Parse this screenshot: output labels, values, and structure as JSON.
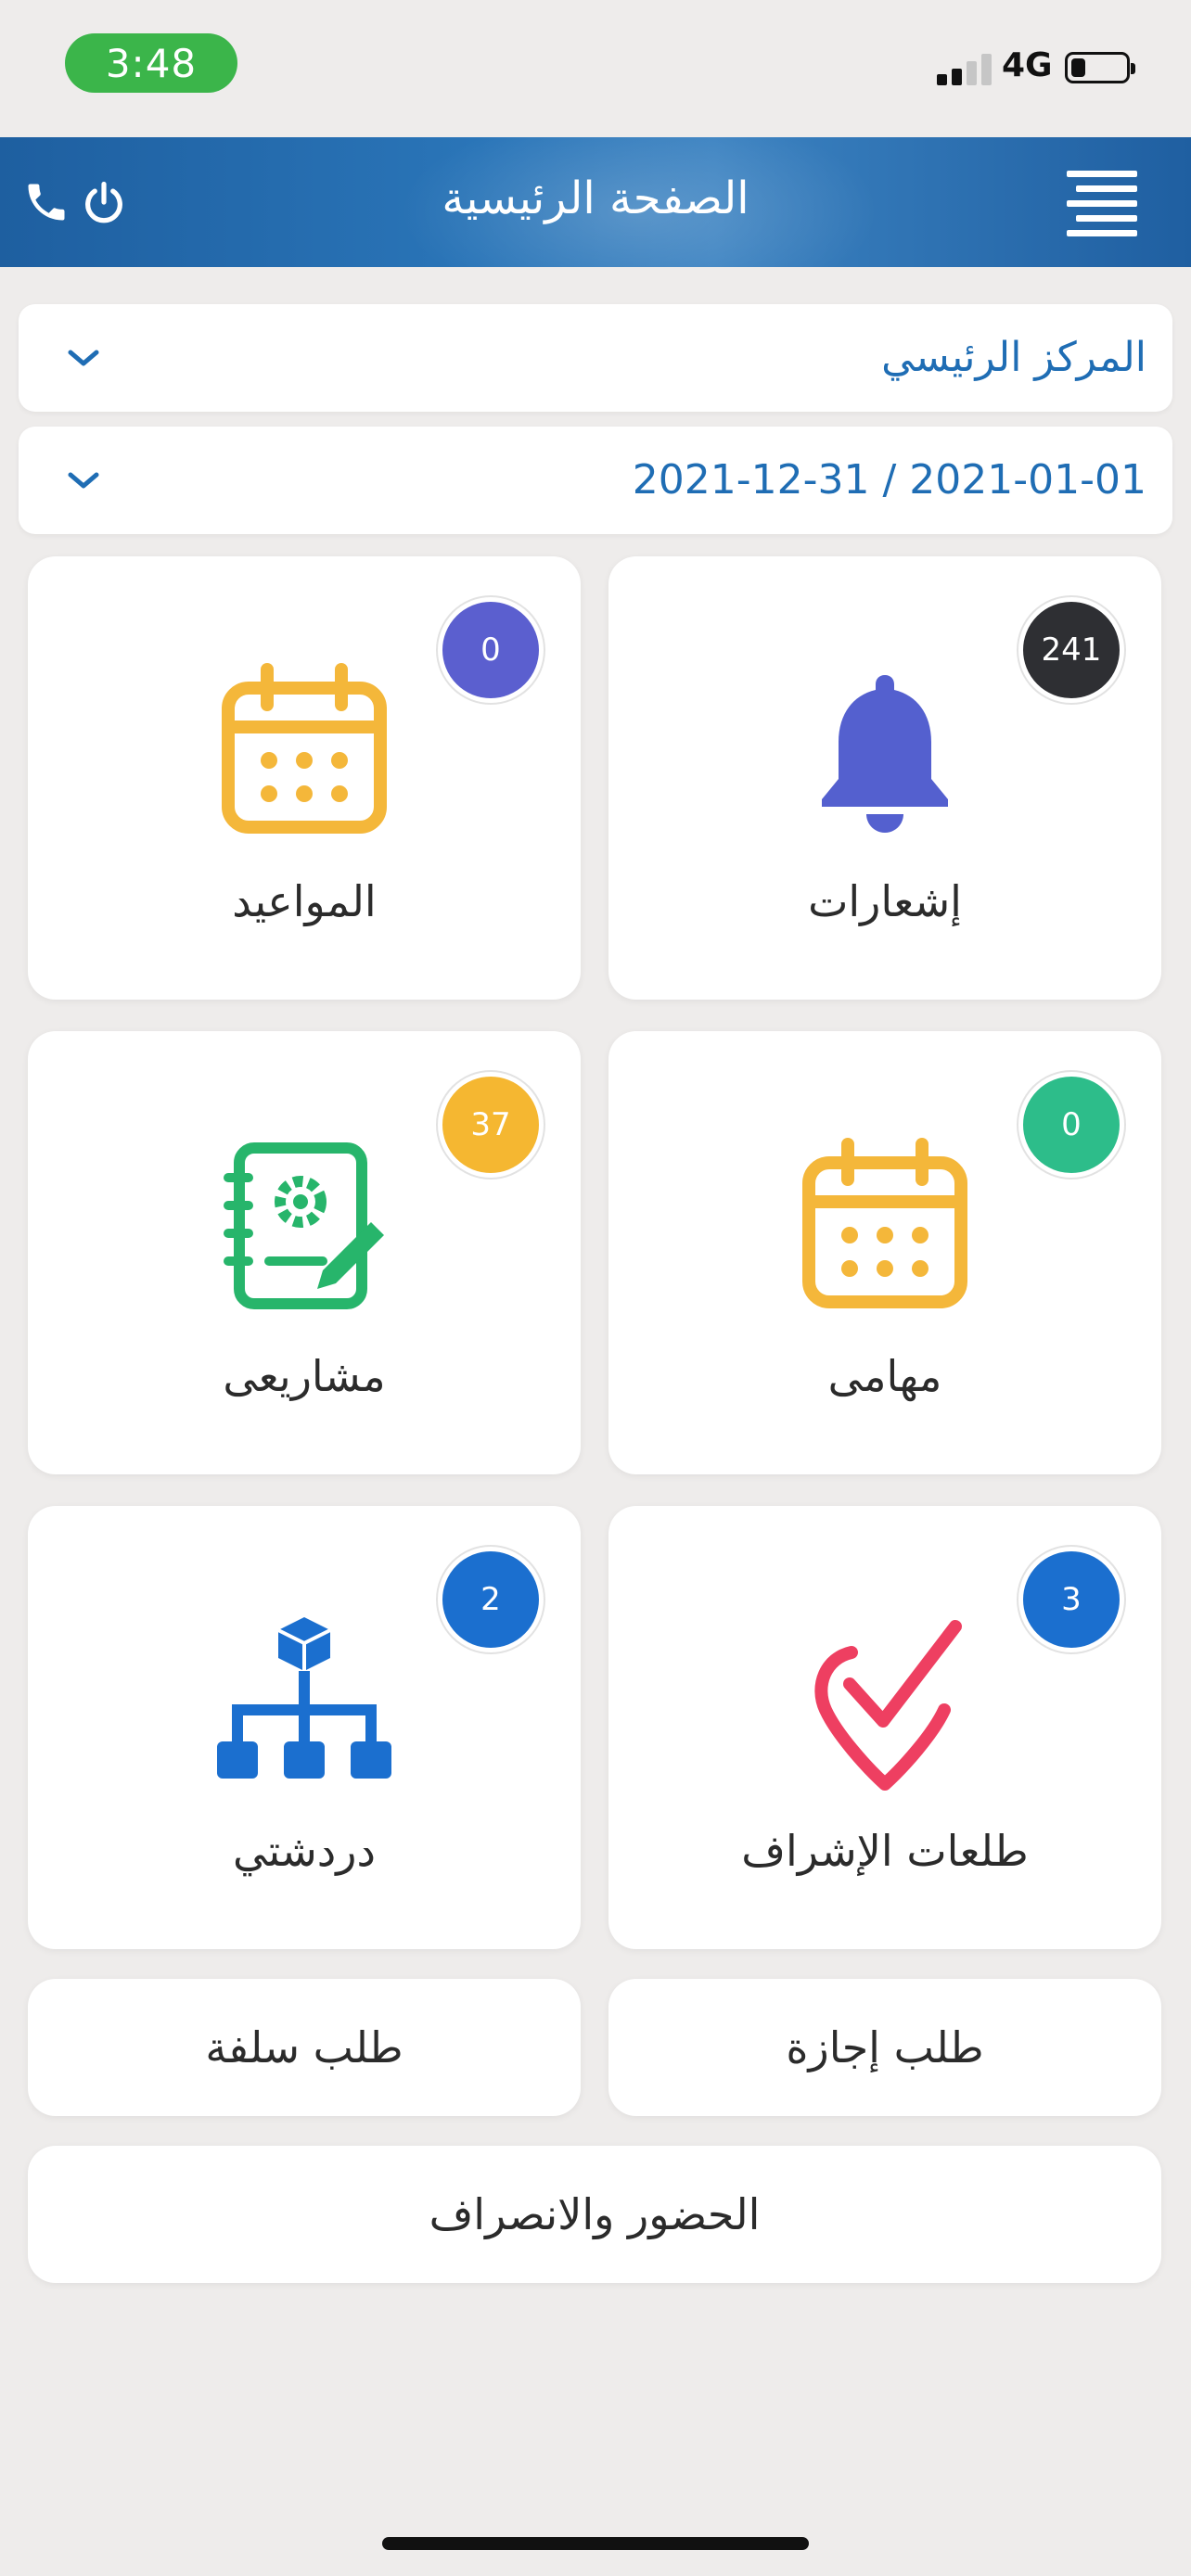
{
  "status_bar": {
    "time": "3:48",
    "network": "4G",
    "signal_bars": 2,
    "battery_level": 0.25
  },
  "header": {
    "title": "الصفحة الرئيسية"
  },
  "filters": {
    "center": "المركز الرئيسي",
    "date_range": "2021-12-31 / 2021-01-01"
  },
  "cards": [
    {
      "label": "إشعارات",
      "badge": "241",
      "badge_color": "#2e2f33",
      "icon": "bell-icon",
      "icon_color": "#5460cf"
    },
    {
      "label": "المواعيد",
      "badge": "0",
      "badge_color": "#5b5fcf",
      "icon": "calendar-icon",
      "icon_color": "#f4b73a"
    },
    {
      "label": "مهامى",
      "badge": "0",
      "badge_color": "#2dbd8a",
      "icon": "calendar-icon",
      "icon_color": "#f4b73a"
    },
    {
      "label": "مشاريعى",
      "badge": "37",
      "badge_color": "#f5b731",
      "icon": "project-notebook-icon",
      "icon_color": "#27b56b"
    },
    {
      "label": "طلعات الإشراف",
      "badge": "3",
      "badge_color": "#1b6fcf",
      "icon": "location-check-icon",
      "icon_color": "#ee3f61"
    },
    {
      "label": "دردشتي",
      "badge": "2",
      "badge_color": "#1b6fcf",
      "icon": "hierarchy-icon",
      "icon_color": "#1b6fcf"
    }
  ],
  "buttons": {
    "leave_request": "طلب إجازة",
    "advance_request": "طلب سلفة",
    "attendance": "الحضور والانصراف"
  }
}
